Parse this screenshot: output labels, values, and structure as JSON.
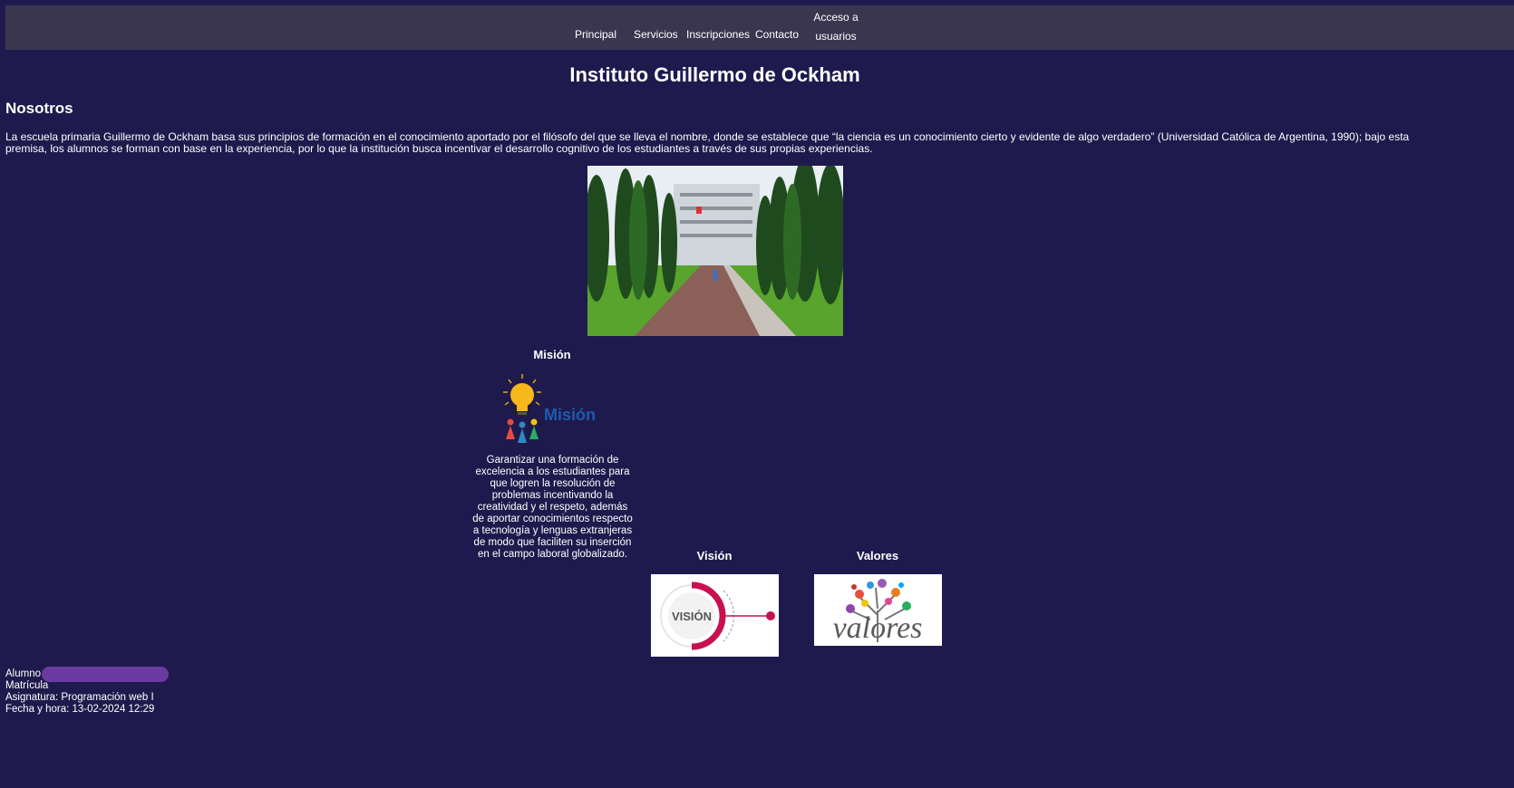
{
  "nav": {
    "items": [
      "Principal",
      "Servicios",
      "Inscripciones",
      "Contacto"
    ],
    "access_line1": "Acceso a",
    "access_line2": "usuarios"
  },
  "header": {
    "title": "Instituto Guillermo de Ockham"
  },
  "about": {
    "heading": "Nosotros",
    "text": "La escuela primaria Guillermo de Ockham basa sus principios de formación en el conocimiento aportado por el filósofo del que se lleva el nombre, donde se establece que “la ciencia es un conocimiento cierto y evidente de algo verdadero” (Universidad Católica de Argentina, 1990); bajo esta premisa, los alumnos se forman con base en la experiencia, por lo que la institución busca incentivar el desarrollo cognitivo de los estudiantes a través de sus propias experiencias."
  },
  "mision": {
    "title": "Misión",
    "image_text": "Misión",
    "text": "Garantizar una formación de excelencia a los estudiantes para que logren la resolución de problemas incentivando la creatividad y el respeto, además de aportar conocimientos respecto a tecnología y lenguas extranjeras de modo que faciliten su inserción en el campo laboral globalizado."
  },
  "vision": {
    "title": "Visión",
    "image_text": "VISIÓN"
  },
  "valores": {
    "title": "Valores",
    "image_text": "valores"
  },
  "footer": {
    "alumno": "Alumno",
    "matricula": "Matrícula",
    "asignatura": "Asignatura: Programación web I",
    "fecha": "Fecha y hora: 13-02-2024 12:29"
  },
  "colors": {
    "background": "#1f1a4d",
    "nav": "#3a3650",
    "vision_accent": "#c8104f",
    "mision_text": "#1e5bb0"
  }
}
